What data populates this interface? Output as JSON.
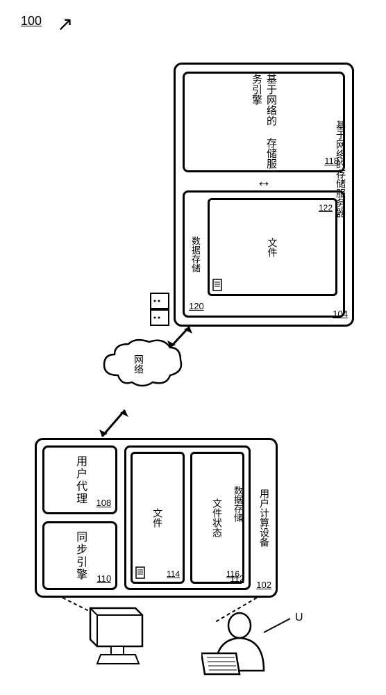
{
  "figure": {
    "number": "100"
  },
  "user_device": {
    "label": "用户计算设备",
    "ref": "102",
    "user_agent": {
      "label": "用户代理",
      "ref": "108"
    },
    "sync_engine": {
      "label": "同步引擎",
      "ref": "110"
    },
    "data_storage": {
      "label": "数据存储",
      "ref": "112",
      "file": {
        "label": "文件",
        "ref": "114"
      },
      "file_status": {
        "label": "文件状态",
        "ref": "116"
      }
    }
  },
  "server": {
    "label": "基于网络的存储服务器",
    "ref": "104",
    "engine": {
      "label": "基于网络的\n存储服务引擎",
      "ref": "118"
    },
    "data_storage": {
      "label": "数据存储",
      "ref": "120",
      "file": {
        "label": "文件",
        "ref": "122"
      }
    }
  },
  "network": {
    "label": "网络"
  },
  "user": {
    "label": "U"
  }
}
